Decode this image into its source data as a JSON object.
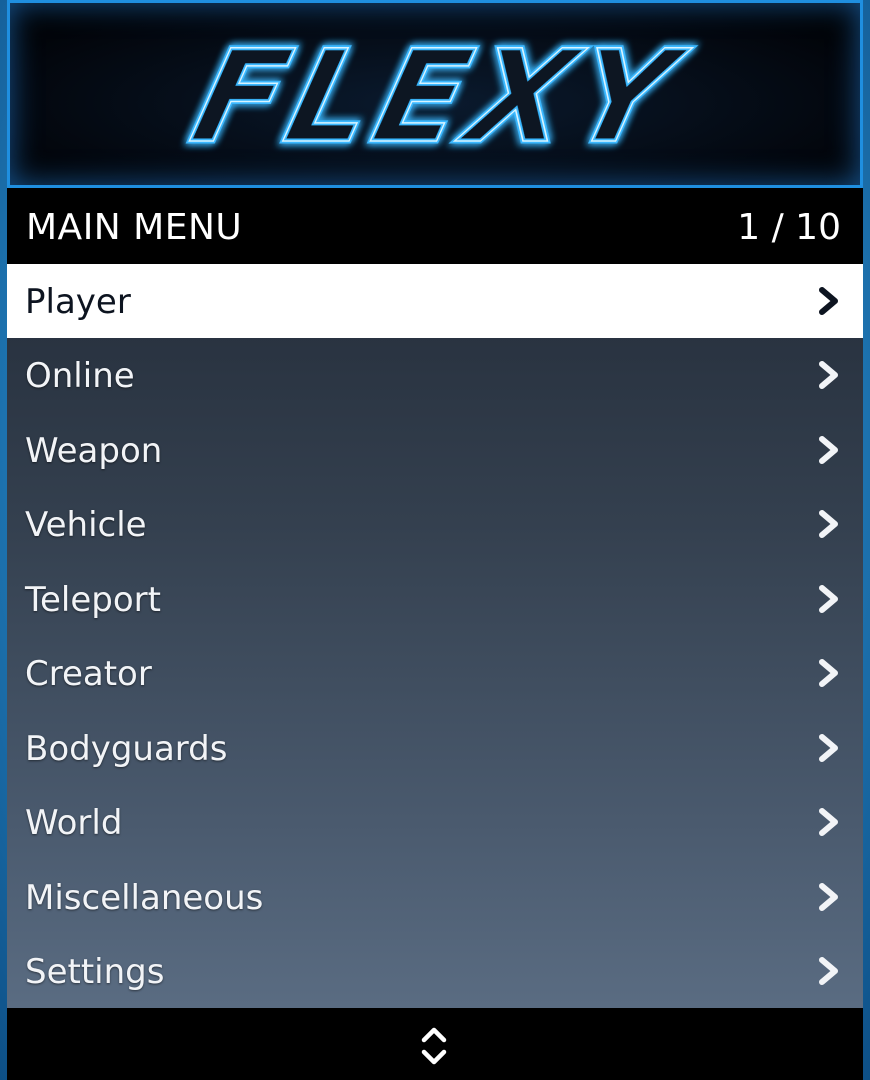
{
  "banner": {
    "logo_text": "FLEXY",
    "logo_color": "#3ab8ff"
  },
  "header": {
    "title": "MAIN MENU",
    "counter": "1 / 10"
  },
  "items": [
    {
      "label": "Player",
      "selected": true
    },
    {
      "label": "Online",
      "selected": false
    },
    {
      "label": "Weapon",
      "selected": false
    },
    {
      "label": "Vehicle",
      "selected": false
    },
    {
      "label": "Teleport",
      "selected": false
    },
    {
      "label": "Creator",
      "selected": false
    },
    {
      "label": "Bodyguards",
      "selected": false
    },
    {
      "label": "World",
      "selected": false
    },
    {
      "label": "Miscellaneous",
      "selected": false
    },
    {
      "label": "Settings",
      "selected": false
    }
  ],
  "icons": {
    "item_arrow": "chevron-right-icon",
    "footer": "up-down-scroll-icon"
  },
  "colors": {
    "selected_bg": "#ffffff",
    "selected_text": "#0d1420",
    "item_text": "#f2f4f7",
    "header_bg": "#000000",
    "accent_glow": "#1f8fe0"
  }
}
